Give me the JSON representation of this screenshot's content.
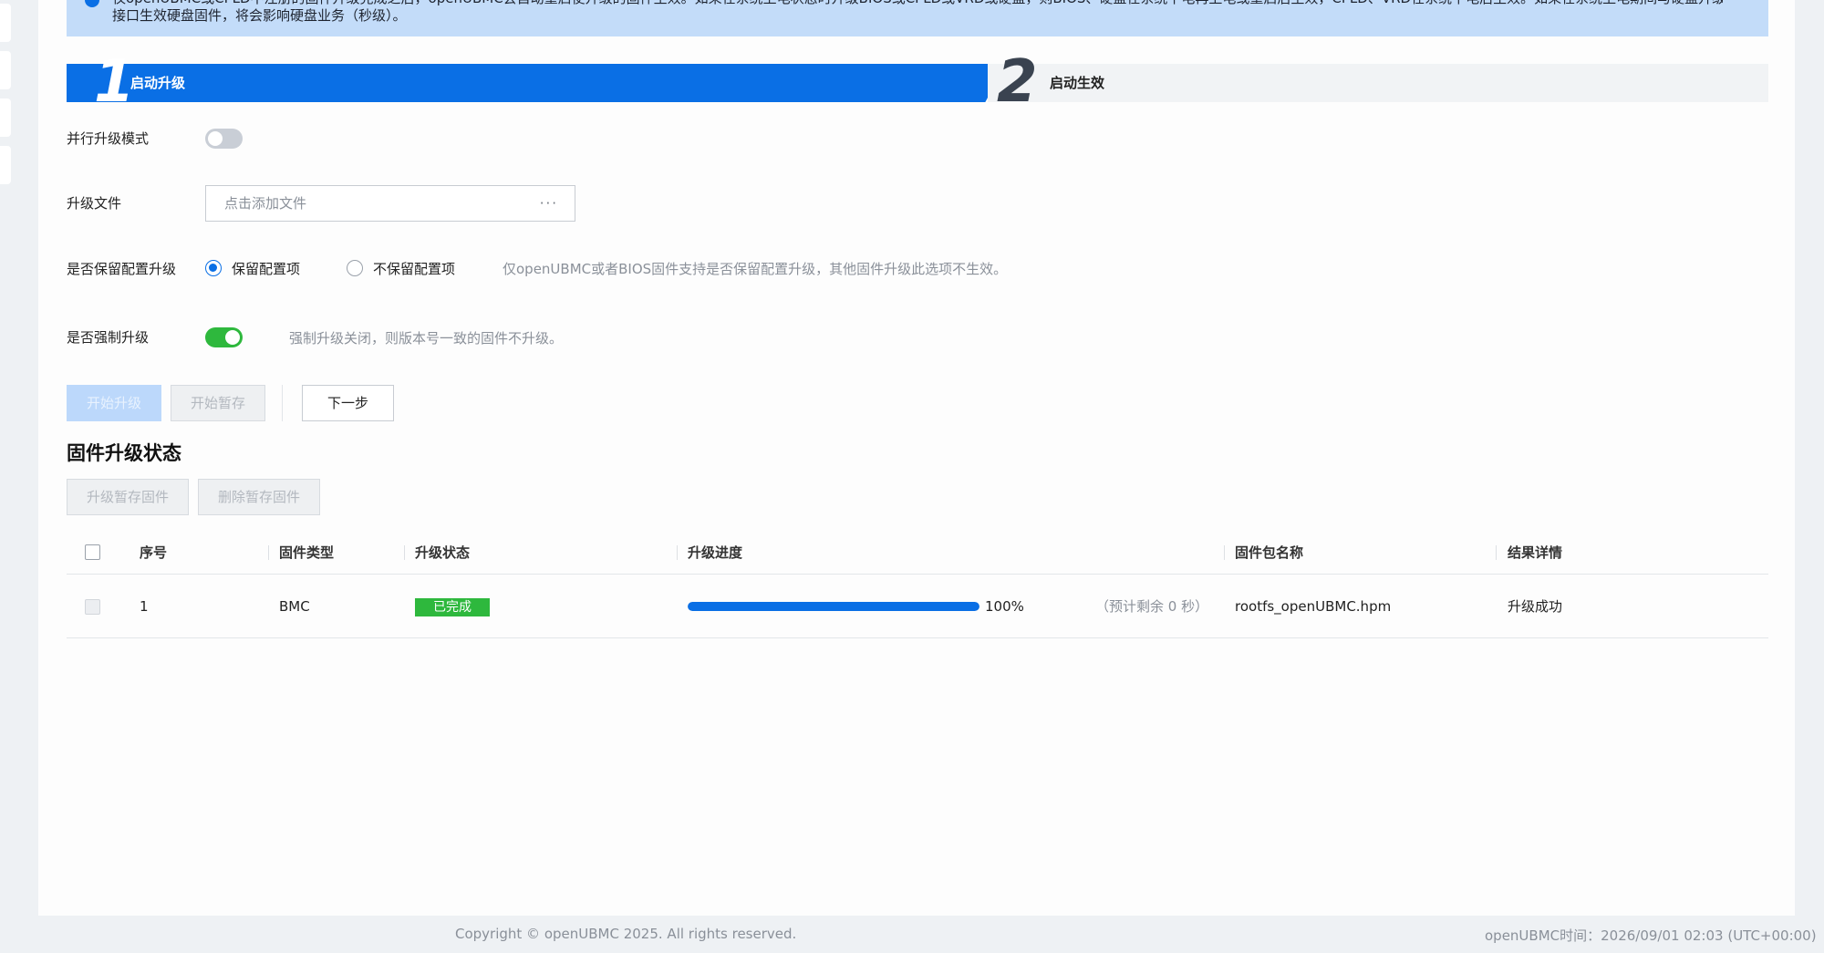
{
  "notice": {
    "line1": "仅openUBMC或CPLD不注册的固件升级完成之后，openUBMC会自动重启使升级的固件生效。如果在系统上电状态时升级BIOS或CPLD或VRD或硬盘，则BIOS、硬盘在系统下电再上电或重启后生效，CPLD、VRD在系统下电后生效。如果在系统上电期间与硬盘升级",
    "line2": "接口生效硬盘固件，将会影响硬盘业务（秒级）。"
  },
  "steps": [
    {
      "number": "1",
      "label": "启动升级"
    },
    {
      "number": "2",
      "label": "启动生效"
    }
  ],
  "form": {
    "parallel_mode_label": "并行升级模式",
    "parallel_mode_on": false,
    "upgrade_file_label": "升级文件",
    "upgrade_file_placeholder": "点击添加文件",
    "upgrade_file_more": "···",
    "keep_config_label": "是否保留配置升级",
    "keep_config_option_yes": "保留配置项",
    "keep_config_option_no": "不保留配置项",
    "keep_config_selected": "保留配置项",
    "keep_config_hint": "仅openUBMC或者BIOS固件支持是否保留配置升级，其他固件升级此选项不生效。",
    "force_upgrade_label": "是否强制升级",
    "force_upgrade_on": true,
    "force_upgrade_hint": "强制升级关闭，则版本号一致的固件不升级。"
  },
  "actions": {
    "start_upgrade": "开始升级",
    "start_stage": "开始暂存",
    "next_step": "下一步"
  },
  "status_section": {
    "title": "固件升级状态",
    "upgrade_staged": "升级暂存固件",
    "delete_staged": "删除暂存固件",
    "columns": [
      "序号",
      "固件类型",
      "升级状态",
      "升级进度",
      "固件包名称",
      "结果详情"
    ],
    "rows": [
      {
        "index": "1",
        "type": "BMC",
        "status": "已完成",
        "progress": 1.0,
        "progress_text": "100%",
        "remaining": "（预计剩余 0 秒）",
        "package": "rootfs_openUBMC.hpm",
        "result": "升级成功"
      }
    ]
  },
  "colors": {
    "primary": "#0a6fe5",
    "success": "#2eb83d",
    "notice_bg": "#c3dcf9"
  },
  "footer": {
    "copyright": "Copyright © openUBMC 2025. All rights reserved.",
    "time": "openUBMC时间：2026/09/01 02:03 (UTC+00:00)"
  }
}
